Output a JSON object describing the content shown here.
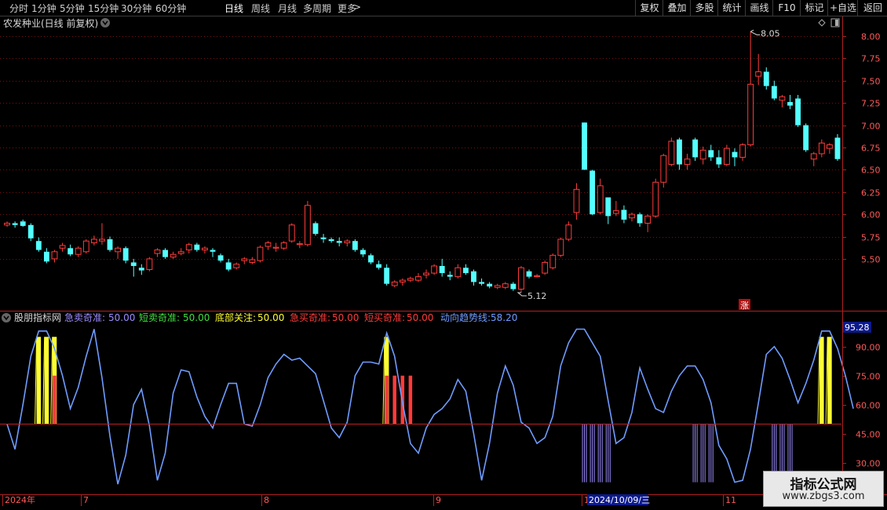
{
  "toolbar": {
    "periods": [
      "分时",
      "1分钟",
      "5分钟",
      "15分钟",
      "30分钟",
      "60分钟",
      "日线",
      "周线",
      "月线",
      "多周期",
      "更多"
    ],
    "active_period": "日线",
    "more_arrow": ">",
    "right_buttons": [
      "复权",
      "叠加",
      "多股",
      "统计",
      "画线",
      "F10",
      "标记",
      "+自选",
      "返回"
    ]
  },
  "price_panel": {
    "title": "农发种业(日线 前复权)",
    "high_label": "8.05",
    "low_label": "5.12",
    "zhang_badge": "涨"
  },
  "indicator_panel": {
    "name": "股朋指标网",
    "legend": [
      {
        "label": "急卖奇准:",
        "value": "50.00",
        "color": "#9b8cff"
      },
      {
        "label": "短卖奇准:",
        "value": "50.00",
        "color": "#3ee03e"
      },
      {
        "label": "底部关注:",
        "value": "50.00",
        "color": "#ffff33"
      },
      {
        "label": "急买奇准:",
        "value": "50.00",
        "color": "#ff3b3b"
      },
      {
        "label": "短买奇准:",
        "value": "50.00",
        "color": "#ff3b3b"
      },
      {
        "label": "动向趋势线:",
        "value": "58.20",
        "color": "#6f9cff"
      }
    ],
    "top_value": "95.28"
  },
  "date_axis": {
    "labels": [
      "2024年",
      "7",
      "8",
      "9",
      "1",
      "11"
    ],
    "cursor_date": "2024/10/09/三"
  },
  "watermark": {
    "title": "指标公式网",
    "url": "www.zbgs3.com"
  },
  "colors": {
    "up": "#ff3b3b",
    "down": "#54ffff",
    "line": "#6f9cff",
    "yellow": "#ffff33",
    "purple": "#9b8cff",
    "grid": "#7a1010",
    "axis": "#b02020"
  },
  "chart_data": [
    {
      "type": "candlestick",
      "title": "农发种业(日线 前复权)",
      "yticks": [
        8.0,
        7.75,
        7.5,
        7.25,
        7.0,
        6.75,
        6.5,
        6.25,
        6.0,
        5.75,
        5.5
      ],
      "ylim": [
        5.05,
        8.15
      ],
      "grid": true,
      "ohlc": [
        [
          5.88,
          5.92,
          5.86,
          5.9
        ],
        [
          5.9,
          5.92,
          5.85,
          5.88
        ],
        [
          5.92,
          5.94,
          5.86,
          5.87
        ],
        [
          5.88,
          5.9,
          5.7,
          5.73
        ],
        [
          5.7,
          5.74,
          5.58,
          5.6
        ],
        [
          5.58,
          5.62,
          5.45,
          5.47
        ],
        [
          5.5,
          5.6,
          5.46,
          5.58
        ],
        [
          5.62,
          5.68,
          5.58,
          5.65
        ],
        [
          5.62,
          5.66,
          5.53,
          5.55
        ],
        [
          5.55,
          5.64,
          5.52,
          5.62
        ],
        [
          5.58,
          5.72,
          5.56,
          5.7
        ],
        [
          5.68,
          5.76,
          5.65,
          5.72
        ],
        [
          5.7,
          5.9,
          5.66,
          5.72
        ],
        [
          5.72,
          5.75,
          5.58,
          5.6
        ],
        [
          5.58,
          5.64,
          5.5,
          5.62
        ],
        [
          5.62,
          5.64,
          5.45,
          5.48
        ],
        [
          5.46,
          5.5,
          5.3,
          5.42
        ],
        [
          5.4,
          5.44,
          5.32,
          5.37
        ],
        [
          5.38,
          5.52,
          5.36,
          5.5
        ],
        [
          5.56,
          5.62,
          5.52,
          5.6
        ],
        [
          5.6,
          5.62,
          5.5,
          5.52
        ],
        [
          5.52,
          5.58,
          5.5,
          5.55
        ],
        [
          5.56,
          5.62,
          5.54,
          5.58
        ],
        [
          5.6,
          5.68,
          5.56,
          5.66
        ],
        [
          5.66,
          5.68,
          5.58,
          5.6
        ],
        [
          5.6,
          5.64,
          5.56,
          5.62
        ],
        [
          5.6,
          5.62,
          5.52,
          5.58
        ],
        [
          5.54,
          5.56,
          5.46,
          5.48
        ],
        [
          5.46,
          5.5,
          5.36,
          5.38
        ],
        [
          5.4,
          5.46,
          5.38,
          5.44
        ],
        [
          5.48,
          5.52,
          5.44,
          5.5
        ],
        [
          5.46,
          5.52,
          5.44,
          5.49
        ],
        [
          5.48,
          5.65,
          5.46,
          5.63
        ],
        [
          5.64,
          5.7,
          5.6,
          5.68
        ],
        [
          5.62,
          5.68,
          5.58,
          5.63
        ],
        [
          5.62,
          5.7,
          5.6,
          5.68
        ],
        [
          5.7,
          5.9,
          5.68,
          5.88
        ],
        [
          5.66,
          5.7,
          5.62,
          5.67
        ],
        [
          5.66,
          6.15,
          5.64,
          6.1
        ],
        [
          5.9,
          5.92,
          5.76,
          5.78
        ],
        [
          5.74,
          5.78,
          5.68,
          5.72
        ],
        [
          5.72,
          5.74,
          5.68,
          5.7
        ],
        [
          5.7,
          5.74,
          5.64,
          5.68
        ],
        [
          5.68,
          5.72,
          5.64,
          5.7
        ],
        [
          5.7,
          5.72,
          5.58,
          5.6
        ],
        [
          5.6,
          5.62,
          5.52,
          5.55
        ],
        [
          5.54,
          5.56,
          5.44,
          5.46
        ],
        [
          5.44,
          5.48,
          5.38,
          5.4
        ],
        [
          5.4,
          5.44,
          5.2,
          5.22
        ],
        [
          5.2,
          5.26,
          5.18,
          5.24
        ],
        [
          5.24,
          5.28,
          5.2,
          5.26
        ],
        [
          5.26,
          5.3,
          5.24,
          5.28
        ],
        [
          5.26,
          5.34,
          5.24,
          5.3
        ],
        [
          5.32,
          5.38,
          5.28,
          5.34
        ],
        [
          5.34,
          5.44,
          5.32,
          5.42
        ],
        [
          5.42,
          5.5,
          5.3,
          5.34
        ],
        [
          5.32,
          5.36,
          5.26,
          5.3
        ],
        [
          5.3,
          5.44,
          5.28,
          5.4
        ],
        [
          5.4,
          5.44,
          5.32,
          5.34
        ],
        [
          5.36,
          5.38,
          5.2,
          5.24
        ],
        [
          5.24,
          5.28,
          5.2,
          5.22
        ],
        [
          5.22,
          5.24,
          5.17,
          5.19
        ],
        [
          5.18,
          5.22,
          5.16,
          5.2
        ],
        [
          5.18,
          5.24,
          5.16,
          5.22
        ],
        [
          5.22,
          5.24,
          5.14,
          5.16
        ],
        [
          5.16,
          5.42,
          5.12,
          5.4
        ],
        [
          5.36,
          5.38,
          5.28,
          5.3
        ],
        [
          5.3,
          5.33,
          5.29,
          5.31
        ],
        [
          5.34,
          5.48,
          5.32,
          5.46
        ],
        [
          5.4,
          5.56,
          5.38,
          5.54
        ],
        [
          5.54,
          5.74,
          5.52,
          5.72
        ],
        [
          5.72,
          5.92,
          5.7,
          5.88
        ],
        [
          6.02,
          6.35,
          5.94,
          6.28
        ],
        [
          7.03,
          7.03,
          6.5,
          6.5
        ],
        [
          6.49,
          6.5,
          5.99,
          6.0
        ],
        [
          6.02,
          6.4,
          6.0,
          6.32
        ],
        [
          6.19,
          6.19,
          5.89,
          5.98
        ],
        [
          6.01,
          6.15,
          5.98,
          6.04
        ],
        [
          6.05,
          6.1,
          5.9,
          5.94
        ],
        [
          5.96,
          6.02,
          5.92,
          6.0
        ],
        [
          6.0,
          6.02,
          5.86,
          5.9
        ],
        [
          5.9,
          6.0,
          5.8,
          5.98
        ],
        [
          5.98,
          6.4,
          5.96,
          6.36
        ],
        [
          6.36,
          6.68,
          6.3,
          6.66
        ],
        [
          6.56,
          6.86,
          6.54,
          6.82
        ],
        [
          6.84,
          6.86,
          6.5,
          6.56
        ],
        [
          6.56,
          6.68,
          6.5,
          6.62
        ],
        [
          6.84,
          6.86,
          6.6,
          6.64
        ],
        [
          6.62,
          6.76,
          6.56,
          6.72
        ],
        [
          6.72,
          6.78,
          6.6,
          6.64
        ],
        [
          6.64,
          6.72,
          6.52,
          6.56
        ],
        [
          6.56,
          6.78,
          6.54,
          6.74
        ],
        [
          6.7,
          6.74,
          6.54,
          6.64
        ],
        [
          6.64,
          6.8,
          6.6,
          6.78
        ],
        [
          6.78,
          8.05,
          6.76,
          7.46
        ],
        [
          7.55,
          7.8,
          7.45,
          7.6
        ],
        [
          7.6,
          7.65,
          7.4,
          7.44
        ],
        [
          7.44,
          7.5,
          7.28,
          7.3
        ],
        [
          7.28,
          7.34,
          7.2,
          7.32
        ],
        [
          7.26,
          7.34,
          7.18,
          7.22
        ],
        [
          7.3,
          7.34,
          6.98,
          7.0
        ],
        [
          7.0,
          7.02,
          6.7,
          6.72
        ],
        [
          6.62,
          6.7,
          6.54,
          6.68
        ],
        [
          6.68,
          6.84,
          6.64,
          6.8
        ],
        [
          6.74,
          6.8,
          6.68,
          6.78
        ],
        [
          6.86,
          6.9,
          6.6,
          6.62
        ]
      ]
    },
    {
      "type": "line",
      "title": "股朋指标网",
      "yticks": [
        90.0,
        75.0,
        60.0,
        45.0,
        30.0
      ],
      "ylim": [
        15,
        100
      ],
      "baseline": 50,
      "series": [
        {
          "name": "动向趋势线",
          "values": [
            50,
            37,
            60,
            85,
            98,
            98,
            89,
            75,
            58,
            69,
            85,
            99,
            74,
            44,
            19,
            34,
            60,
            68,
            49,
            21,
            35,
            66,
            78,
            77,
            64,
            54,
            48,
            60,
            71,
            71,
            50,
            49,
            60,
            74,
            81,
            86,
            83,
            84,
            80,
            76,
            62,
            48,
            43,
            51,
            75,
            82,
            82,
            81,
            97,
            85,
            61,
            40,
            35,
            48,
            55,
            58,
            63,
            73,
            67,
            45,
            21,
            40,
            66,
            80,
            70,
            51,
            48,
            40,
            43,
            54,
            80,
            92,
            99,
            99,
            92,
            85,
            62,
            40,
            43,
            56,
            79,
            68,
            58,
            56,
            67,
            75,
            80,
            80,
            73,
            61,
            39,
            32,
            20,
            21,
            37,
            61,
            86,
            90,
            84,
            73,
            61,
            71,
            83,
            98,
            98,
            89,
            75,
            58
          ]
        },
        {
          "name": "底部关注",
          "bars": [
            {
              "at": 4,
              "top": 95
            },
            {
              "at": 5,
              "top": 95
            },
            {
              "at": 6,
              "top": 95
            },
            {
              "at": 48,
              "top": 95
            },
            {
              "at": 103,
              "top": 95
            },
            {
              "at": 104,
              "top": 95
            }
          ]
        },
        {
          "name": "急买奇准",
          "bars": [
            {
              "at": 6,
              "top": 75
            },
            {
              "at": 48,
              "top": 75
            },
            {
              "at": 49,
              "top": 75
            },
            {
              "at": 50,
              "top": 75
            },
            {
              "at": 51,
              "top": 75
            }
          ]
        },
        {
          "name": "急卖奇准",
          "bars": [
            {
              "at": 73,
              "bottom": 20
            },
            {
              "at": 74,
              "bottom": 20
            },
            {
              "at": 75,
              "bottom": 20
            },
            {
              "at": 76,
              "bottom": 20
            },
            {
              "at": 87,
              "bottom": 20
            },
            {
              "at": 88,
              "bottom": 20
            },
            {
              "at": 89,
              "bottom": 20
            },
            {
              "at": 97,
              "bottom": 20
            },
            {
              "at": 98,
              "bottom": 20
            },
            {
              "at": 99,
              "bottom": 20
            }
          ]
        }
      ]
    }
  ]
}
